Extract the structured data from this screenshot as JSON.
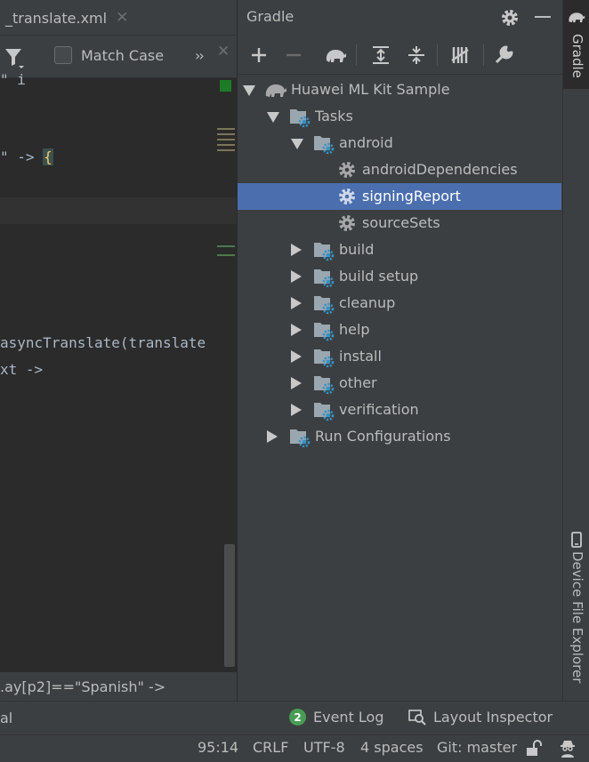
{
  "editor": {
    "tab_label": "_translate.xml",
    "tab_close": "✕",
    "search": {
      "match_case_label": "Match Case",
      "more": "››",
      "close": "✕"
    },
    "code_lines": [
      "\" i",
      "\" -> ",
      "asyncTranslate(translate",
      "xt ->"
    ],
    "brace": "{",
    "breadcrumb": ".ay[p2]==\"Spanish\" ->"
  },
  "gradle": {
    "title": "Gradle",
    "tree": {
      "root": "Huawei ML Kit Sample",
      "tasks": "Tasks",
      "android": "android",
      "android_children": [
        "androidDependencies",
        "signingReport",
        "sourceSets"
      ],
      "groups": [
        "build",
        "build setup",
        "cleanup",
        "help",
        "install",
        "other",
        "verification"
      ],
      "run_configurations": "Run Configurations"
    },
    "selected": "signingReport"
  },
  "right_stripe": {
    "gradle": "Gradle",
    "device_file_explorer": "Device File Explorer"
  },
  "tool_strip": {
    "left_text": "al",
    "event_log_count": "2",
    "event_log": "Event Log",
    "layout_inspector": "Layout Inspector"
  },
  "status_bar": {
    "position": "95:14",
    "line_separator": "CRLF",
    "encoding": "UTF-8",
    "indent": "4 spaces",
    "vcs": "Git: master"
  },
  "colors": {
    "selection": "#4b6eaf",
    "panel_bg": "#3c3f41",
    "editor_bg": "#2b2b2b",
    "folder_blue": "#3592c4",
    "event_badge": "#499c54"
  }
}
